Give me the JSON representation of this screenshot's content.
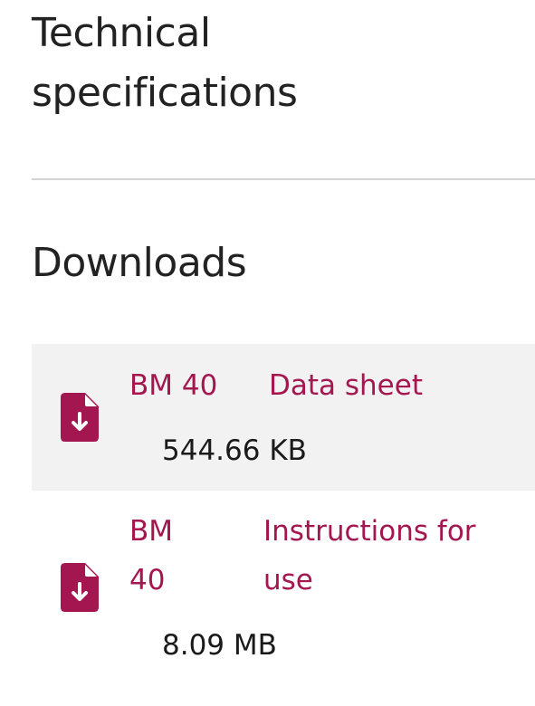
{
  "specs": {
    "title": "Technical specifications"
  },
  "downloads": {
    "title": "Downloads",
    "items": [
      {
        "name": "BM 40",
        "type": "Data sheet",
        "size": "544.66 KB",
        "icon": "file-download-icon"
      },
      {
        "name": "BM 40",
        "type": "Instructions for use",
        "size": "8.09 MB",
        "icon": "file-download-icon"
      }
    ]
  },
  "colors": {
    "accent": "#a3164f",
    "row_bg": "#f2f2f2",
    "divider": "#d4d4d4"
  }
}
